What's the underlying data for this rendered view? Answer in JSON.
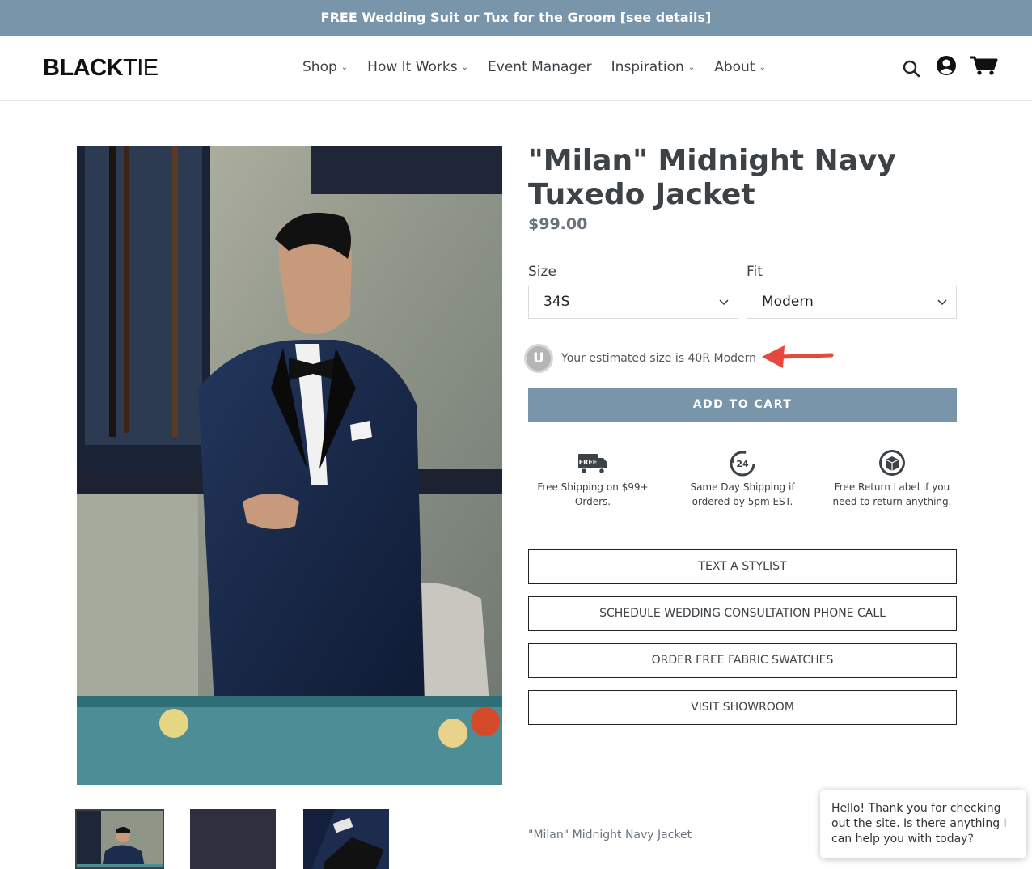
{
  "announcement": "FREE Wedding Suit or Tux for the Groom [see details]",
  "header": {
    "logo_bold": "BLACK",
    "logo_light": "TIE",
    "nav": [
      {
        "label": "Shop",
        "has_dropdown": true
      },
      {
        "label": "How It Works",
        "has_dropdown": true
      },
      {
        "label": "Event Manager",
        "has_dropdown": false
      },
      {
        "label": "Inspiration",
        "has_dropdown": true
      },
      {
        "label": "About",
        "has_dropdown": true
      }
    ],
    "icons": [
      "search-icon",
      "account-icon",
      "cart-icon"
    ]
  },
  "product": {
    "title": "\"Milan\" Midnight Navy Tuxedo Jacket",
    "price": "$99.00",
    "size_label": "Size",
    "size_value": "34S",
    "fit_label": "Fit",
    "fit_value": "Modern",
    "estimate_badge": "U",
    "estimate_text": "Your estimated size is 40R Modern",
    "add_to_cart": "ADD TO CART",
    "perks": [
      {
        "icon": "free-truck-icon",
        "icon_text": "FREE",
        "text": "Free Shipping on $99+ Orders."
      },
      {
        "icon": "24-hour-icon",
        "icon_text": "24",
        "text": "Same Day Shipping if ordered by 5pm EST."
      },
      {
        "icon": "return-box-icon",
        "icon_text": "",
        "text": "Free Return Label if you need to return anything."
      }
    ],
    "action_buttons": [
      "TEXT A STYLIST",
      "SCHEDULE WEDDING CONSULTATION PHONE CALL",
      "ORDER FREE FABRIC SWATCHES",
      "VISIT SHOWROOM"
    ],
    "description": "\"Milan\" Midnight Navy Jacket"
  },
  "chat": {
    "message": "Hello! Thank you for checking out the site. Is there anything I can help you with today?"
  },
  "colors": {
    "accent": "#7895aa",
    "text": "#3d4246",
    "arrow": "#e8473f"
  }
}
